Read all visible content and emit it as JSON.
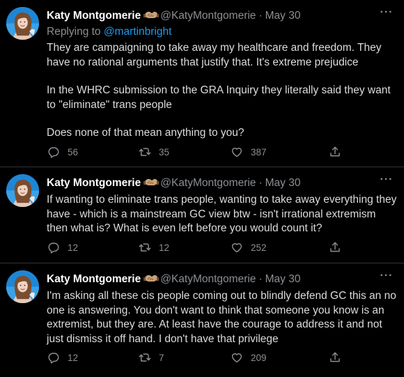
{
  "colors": {
    "background": "#000000",
    "text": "#d9d9d9",
    "secondary": "#8b8f94",
    "link": "#1d9bf0",
    "divider": "#2f3336"
  },
  "tweets": [
    {
      "author": "Katy Montgomerie",
      "badge_icon": "handshake-emoji-icon",
      "handle": "@KatyMontgomerie",
      "separator": "·",
      "date": "May 30",
      "reply_prefix": "Replying to ",
      "reply_to": "@martinbright",
      "paragraphs": [
        "They are campaigning to take away my healthcare and freedom. They have no rational arguments that justify that. It's extreme prejudice",
        "In the WHRC submission to the GRA Inquiry they literally said they want to \"eliminate\" trans people",
        "Does none of that mean anything to you?"
      ],
      "replies": "56",
      "retweets": "35",
      "likes": "387"
    },
    {
      "author": "Katy Montgomerie",
      "badge_icon": "handshake-emoji-icon",
      "handle": "@KatyMontgomerie",
      "separator": "·",
      "date": "May 30",
      "paragraphs": [
        "If wanting to eliminate trans people, wanting to take away everything they have - which is a mainstream GC view btw - isn't irrational extremism then what is? What is even left before you would count it?"
      ],
      "replies": "12",
      "retweets": "12",
      "likes": "252"
    },
    {
      "author": "Katy Montgomerie",
      "badge_icon": "handshake-emoji-icon",
      "handle": "@KatyMontgomerie",
      "separator": "·",
      "date": "May 30",
      "paragraphs": [
        "I'm asking all these cis people coming out to blindly defend GC this an no one is answering. You don't want to think that someone you know is an extremist, but they are. At least have the courage to address it and not just dismiss it off hand. I don't have that privilege"
      ],
      "replies": "12",
      "retweets": "7",
      "likes": "209"
    }
  ]
}
